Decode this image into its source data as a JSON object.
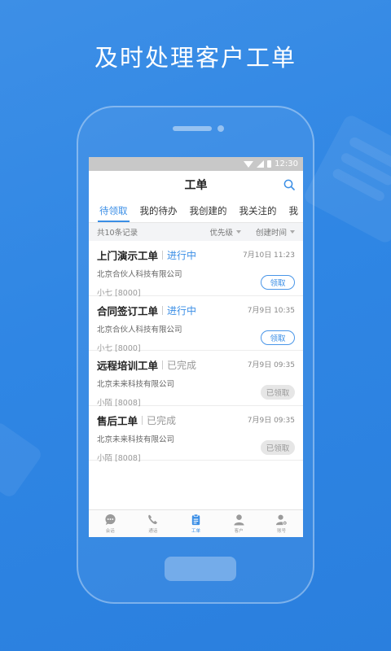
{
  "headline": "及时处理客户工单",
  "status_bar": {
    "time": "12:30"
  },
  "header": {
    "title": "工单",
    "icons": {
      "search": "search-icon"
    }
  },
  "tabs": [
    {
      "label": "待领取",
      "active": true
    },
    {
      "label": "我的待办",
      "active": false
    },
    {
      "label": "我创建的",
      "active": false
    },
    {
      "label": "我关注的",
      "active": false
    },
    {
      "label": "我",
      "active": false
    }
  ],
  "filter": {
    "count": "共10条记录",
    "priority": "优先级",
    "created_time": "创建时间"
  },
  "tickets": [
    {
      "name": "上门演示工单",
      "status": "进行中",
      "status_type": "progress",
      "time": "7月10日 11:23",
      "company": "北京合伙人科技有限公司",
      "person": "小七 [8000]",
      "action": "领取",
      "action_type": "claim"
    },
    {
      "name": "合同签订工单",
      "status": "进行中",
      "status_type": "progress",
      "time": "7月9日 10:35",
      "company": "北京合伙人科技有限公司",
      "person": "小七 [8000]",
      "action": "领取",
      "action_type": "claim"
    },
    {
      "name": "远程培训工单",
      "status": "已完成",
      "status_type": "done",
      "time": "7月9日 09:35",
      "company": "北京未来科技有限公司",
      "person": "小陌 [8008]",
      "action": "已领取",
      "action_type": "claimed"
    },
    {
      "name": "售后工单",
      "status": "已完成",
      "status_type": "done",
      "time": "7月9日 09:35",
      "company": "北京未来科技有限公司",
      "person": "小陌 [8008]",
      "action": "已领取",
      "action_type": "claimed"
    }
  ],
  "bottom_nav": [
    {
      "label": "会话",
      "icon": "chat-icon",
      "active": false
    },
    {
      "label": "通话",
      "icon": "phone-icon",
      "active": false
    },
    {
      "label": "工单",
      "icon": "clipboard-icon",
      "active": true
    },
    {
      "label": "客户",
      "icon": "person-icon",
      "active": false
    },
    {
      "label": "账号",
      "icon": "account-settings-icon",
      "active": false
    }
  ],
  "colors": {
    "accent": "#3a8ee6",
    "background": "#2f86e4"
  }
}
